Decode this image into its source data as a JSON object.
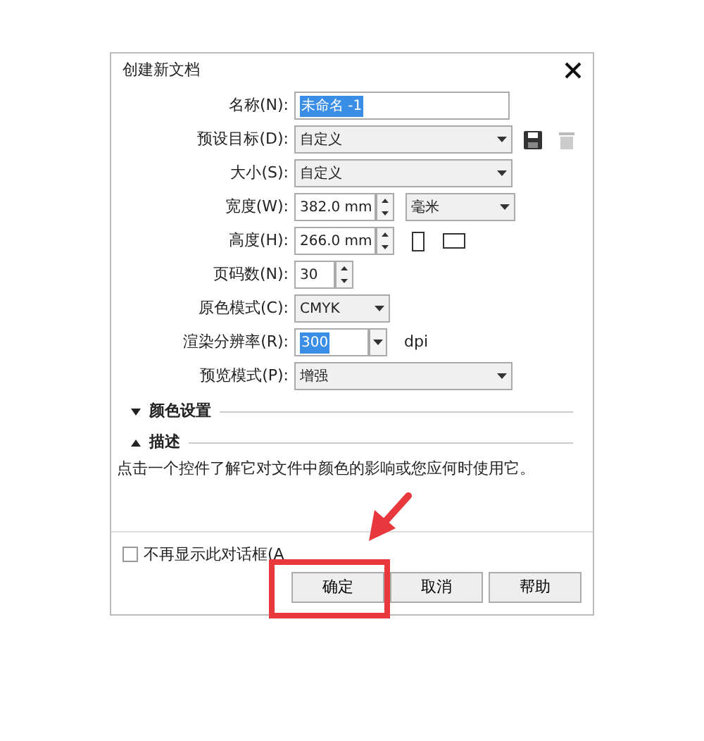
{
  "window": {
    "title": "创建新文档"
  },
  "name": {
    "label": "名称(N):",
    "value": "未命名 -1",
    "selected": true
  },
  "preset": {
    "label": "预设目标(D):",
    "value": "自定义"
  },
  "size": {
    "label": "大小(S):",
    "value": "自定义"
  },
  "width": {
    "label": "宽度(W):",
    "value": "382.0 mm",
    "unit": "毫米"
  },
  "height": {
    "label": "高度(H):",
    "value": "266.0 mm"
  },
  "pages": {
    "label": "页码数(N):",
    "value": "30"
  },
  "color_mode": {
    "label": "原色模式(C):",
    "value": "CMYK"
  },
  "resolution": {
    "label": "渲染分辨率(R):",
    "value": "300",
    "selected": true,
    "unit": "dpi"
  },
  "preview": {
    "label": "预览模式(P):",
    "value": "增强"
  },
  "sections": [
    {
      "title": "颜色设置",
      "expanded": false
    },
    {
      "title": "描述",
      "expanded": true
    }
  ],
  "description": "点击一个控件了解它对文件中颜色的影响或您应何时使用它。",
  "dont_show_again": {
    "label": "不再显示此对话框(A",
    "checked": false
  },
  "buttons": [
    {
      "label": "确定"
    },
    {
      "label": "取消"
    },
    {
      "label": "帮助"
    }
  ]
}
